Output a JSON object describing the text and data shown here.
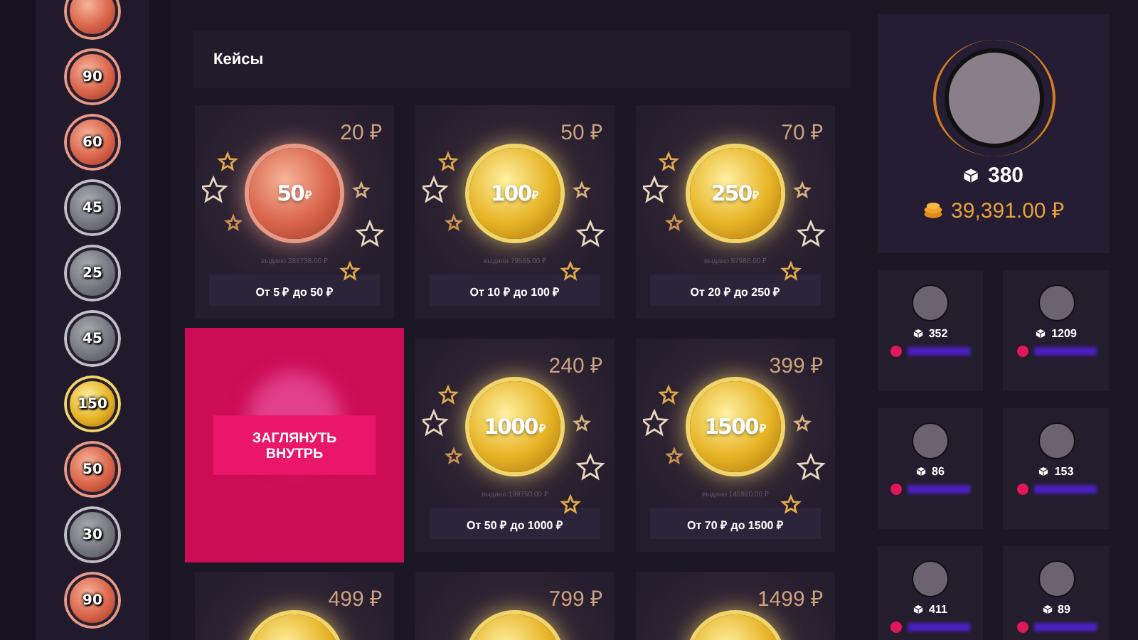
{
  "sidebar": {
    "coins": [
      {
        "kind": "bronze"
      },
      {
        "value": "90",
        "kind": "bronze"
      },
      {
        "value": "60",
        "kind": "bronze"
      },
      {
        "value": "45",
        "kind": "silver"
      },
      {
        "value": "25",
        "kind": "silver"
      },
      {
        "value": "45",
        "kind": "silver"
      },
      {
        "value": "150",
        "kind": "gold"
      },
      {
        "value": "50",
        "kind": "bronze"
      },
      {
        "value": "30",
        "kind": "silver"
      },
      {
        "value": "90",
        "kind": "bronze"
      }
    ]
  },
  "cases": {
    "title": "Кейсы",
    "items": [
      {
        "price": "20 ₽",
        "coin": "50",
        "currency": "₽",
        "kind": "bronze",
        "issued": "выдано 281738.00 ₽",
        "range": "От 5 ₽ до 50 ₽",
        "hovered": false
      },
      {
        "price": "50 ₽",
        "coin": "100",
        "currency": "₽",
        "kind": "gold",
        "issued": "выдано 79565.00 ₽",
        "range": "От 10 ₽ до 100 ₽",
        "hovered": false
      },
      {
        "price": "70 ₽",
        "coin": "250",
        "currency": "₽",
        "kind": "gold",
        "issued": "выдано 57980.00 ₽",
        "range": "От 20 ₽ до 250 ₽",
        "hovered": false
      },
      {
        "button": "ЗАГЛЯНУТЬ ВНУТРЬ",
        "hovered": true
      },
      {
        "price": "240 ₽",
        "coin": "1000",
        "currency": "₽",
        "kind": "gold",
        "issued": "выдано 199750.00 ₽",
        "range": "От 50 ₽ до 1000 ₽",
        "hovered": false
      },
      {
        "price": "399 ₽",
        "coin": "1500",
        "currency": "₽",
        "kind": "gold",
        "issued": "выдано 145920.00 ₽",
        "range": "От 70 ₽ до 1500 ₽",
        "hovered": false
      },
      {
        "price": "499 ₽",
        "kind": "gold",
        "hovered": false
      },
      {
        "price": "799 ₽",
        "kind": "gold",
        "hovered": false
      },
      {
        "price": "1499 ₽",
        "kind": "gold",
        "hovered": false
      }
    ]
  },
  "profile": {
    "cases_opened": "380",
    "balance": "39,391.00 ₽"
  },
  "top_users": [
    {
      "cases_opened": "352"
    },
    {
      "cases_opened": "1209"
    },
    {
      "cases_opened": "86"
    },
    {
      "cases_opened": "153"
    },
    {
      "cases_opened": "411"
    },
    {
      "cases_opened": "89"
    }
  ]
}
